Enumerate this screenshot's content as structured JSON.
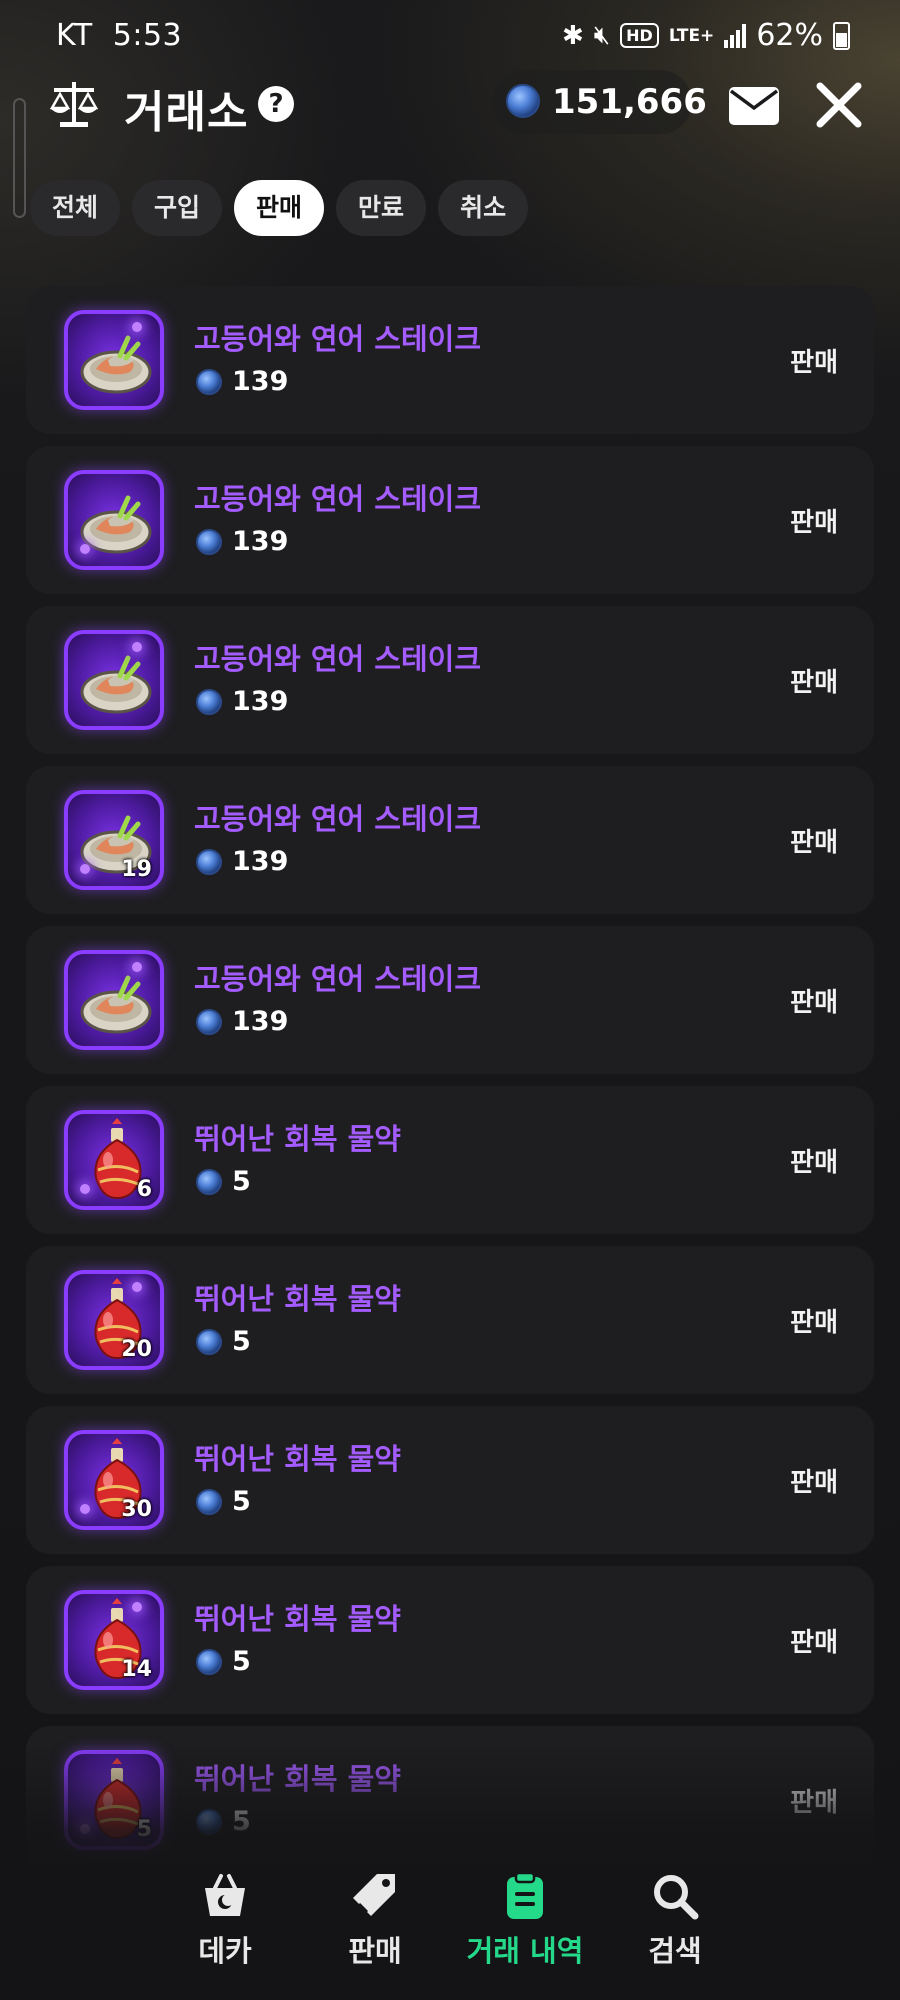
{
  "status_bar": {
    "carrier": "KT",
    "time": "5:53",
    "lte": "LTE+",
    "battery": "62%"
  },
  "header": {
    "title": "거래소",
    "balance": "151,666"
  },
  "tabs": [
    {
      "label": "전체",
      "active": false
    },
    {
      "label": "구입",
      "active": false
    },
    {
      "label": "판매",
      "active": true
    },
    {
      "label": "만료",
      "active": false
    },
    {
      "label": "취소",
      "active": false
    }
  ],
  "listings": [
    {
      "name": "고등어와 연어 스테이크",
      "price": "139",
      "quantity": "",
      "status": "판매",
      "icon": "steak-plate-icon"
    },
    {
      "name": "고등어와 연어 스테이크",
      "price": "139",
      "quantity": "",
      "status": "판매",
      "icon": "steak-plate-icon"
    },
    {
      "name": "고등어와 연어 스테이크",
      "price": "139",
      "quantity": "",
      "status": "판매",
      "icon": "steak-plate-icon"
    },
    {
      "name": "고등어와 연어 스테이크",
      "price": "139",
      "quantity": "19",
      "status": "판매",
      "icon": "steak-plate-icon"
    },
    {
      "name": "고등어와 연어 스테이크",
      "price": "139",
      "quantity": "",
      "status": "판매",
      "icon": "steak-plate-icon"
    },
    {
      "name": "뛰어난 회복 물약",
      "price": "5",
      "quantity": "6",
      "status": "판매",
      "icon": "red-potion-icon"
    },
    {
      "name": "뛰어난 회복 물약",
      "price": "5",
      "quantity": "20",
      "status": "판매",
      "icon": "red-potion-icon"
    },
    {
      "name": "뛰어난 회복 물약",
      "price": "5",
      "quantity": "30",
      "status": "판매",
      "icon": "red-potion-icon"
    },
    {
      "name": "뛰어난 회복 물약",
      "price": "5",
      "quantity": "14",
      "status": "판매",
      "icon": "red-potion-icon"
    },
    {
      "name": "뛰어난 회복 물약",
      "price": "5",
      "quantity": "5",
      "status": "판매",
      "icon": "red-potion-icon"
    }
  ],
  "bottom_nav": [
    {
      "label": "데카",
      "icon": "basket-icon",
      "active": false
    },
    {
      "label": "판매",
      "icon": "tag-icon",
      "active": false
    },
    {
      "label": "거래 내역",
      "icon": "clipboard-icon",
      "active": true
    },
    {
      "label": "검색",
      "icon": "search-icon",
      "active": false
    }
  ],
  "colors": {
    "item_name": "#a45cff",
    "active_nav": "#25d98a",
    "thumb_border": "#8a3dff"
  }
}
